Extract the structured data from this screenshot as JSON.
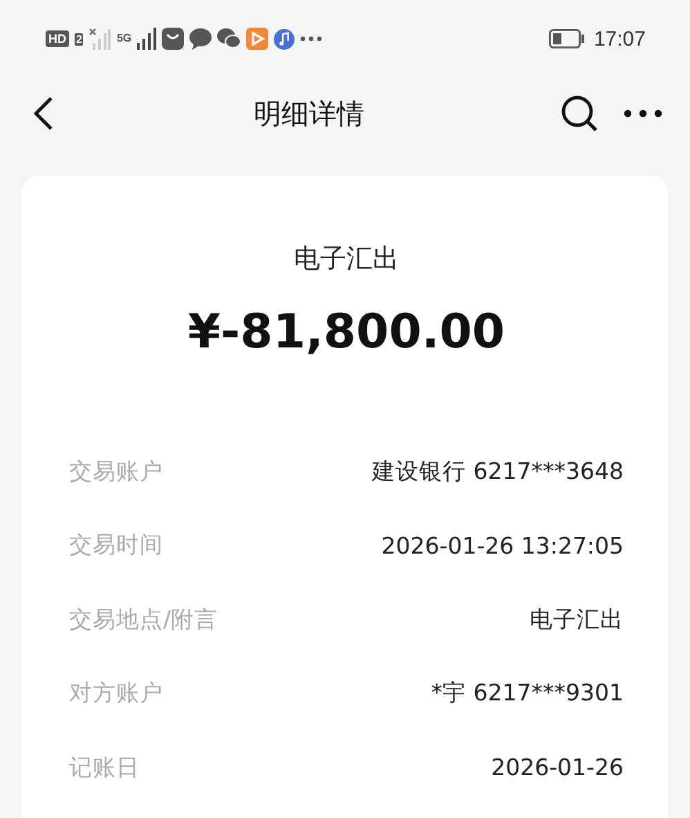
{
  "status_bar": {
    "hd": "HD",
    "sim": "2",
    "network": "5G",
    "time": "17:07"
  },
  "nav": {
    "title": "明细详情"
  },
  "summary": {
    "type": "电子汇出",
    "amount": "¥-81,800.00"
  },
  "details": [
    {
      "label": "交易账户",
      "value": "建设银行 6217***3648"
    },
    {
      "label": "交易时间",
      "value": "2026-01-26 13:27:05"
    },
    {
      "label": "交易地点/附言",
      "value": "电子汇出"
    },
    {
      "label": "对方账户",
      "value": "*宇 6217***9301"
    },
    {
      "label": "记账日",
      "value": "2026-01-26"
    }
  ]
}
